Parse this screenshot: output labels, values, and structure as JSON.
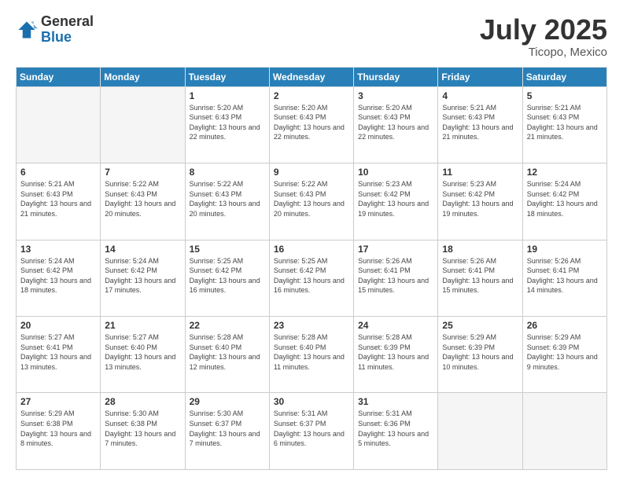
{
  "header": {
    "logo_general": "General",
    "logo_blue": "Blue",
    "month_title": "July 2025",
    "location": "Ticopo, Mexico"
  },
  "calendar": {
    "days_of_week": [
      "Sunday",
      "Monday",
      "Tuesday",
      "Wednesday",
      "Thursday",
      "Friday",
      "Saturday"
    ],
    "weeks": [
      [
        {
          "day": "",
          "info": ""
        },
        {
          "day": "",
          "info": ""
        },
        {
          "day": "1",
          "info": "Sunrise: 5:20 AM\nSunset: 6:43 PM\nDaylight: 13 hours and 22 minutes."
        },
        {
          "day": "2",
          "info": "Sunrise: 5:20 AM\nSunset: 6:43 PM\nDaylight: 13 hours and 22 minutes."
        },
        {
          "day": "3",
          "info": "Sunrise: 5:20 AM\nSunset: 6:43 PM\nDaylight: 13 hours and 22 minutes."
        },
        {
          "day": "4",
          "info": "Sunrise: 5:21 AM\nSunset: 6:43 PM\nDaylight: 13 hours and 21 minutes."
        },
        {
          "day": "5",
          "info": "Sunrise: 5:21 AM\nSunset: 6:43 PM\nDaylight: 13 hours and 21 minutes."
        }
      ],
      [
        {
          "day": "6",
          "info": "Sunrise: 5:21 AM\nSunset: 6:43 PM\nDaylight: 13 hours and 21 minutes."
        },
        {
          "day": "7",
          "info": "Sunrise: 5:22 AM\nSunset: 6:43 PM\nDaylight: 13 hours and 20 minutes."
        },
        {
          "day": "8",
          "info": "Sunrise: 5:22 AM\nSunset: 6:43 PM\nDaylight: 13 hours and 20 minutes."
        },
        {
          "day": "9",
          "info": "Sunrise: 5:22 AM\nSunset: 6:43 PM\nDaylight: 13 hours and 20 minutes."
        },
        {
          "day": "10",
          "info": "Sunrise: 5:23 AM\nSunset: 6:42 PM\nDaylight: 13 hours and 19 minutes."
        },
        {
          "day": "11",
          "info": "Sunrise: 5:23 AM\nSunset: 6:42 PM\nDaylight: 13 hours and 19 minutes."
        },
        {
          "day": "12",
          "info": "Sunrise: 5:24 AM\nSunset: 6:42 PM\nDaylight: 13 hours and 18 minutes."
        }
      ],
      [
        {
          "day": "13",
          "info": "Sunrise: 5:24 AM\nSunset: 6:42 PM\nDaylight: 13 hours and 18 minutes."
        },
        {
          "day": "14",
          "info": "Sunrise: 5:24 AM\nSunset: 6:42 PM\nDaylight: 13 hours and 17 minutes."
        },
        {
          "day": "15",
          "info": "Sunrise: 5:25 AM\nSunset: 6:42 PM\nDaylight: 13 hours and 16 minutes."
        },
        {
          "day": "16",
          "info": "Sunrise: 5:25 AM\nSunset: 6:42 PM\nDaylight: 13 hours and 16 minutes."
        },
        {
          "day": "17",
          "info": "Sunrise: 5:26 AM\nSunset: 6:41 PM\nDaylight: 13 hours and 15 minutes."
        },
        {
          "day": "18",
          "info": "Sunrise: 5:26 AM\nSunset: 6:41 PM\nDaylight: 13 hours and 15 minutes."
        },
        {
          "day": "19",
          "info": "Sunrise: 5:26 AM\nSunset: 6:41 PM\nDaylight: 13 hours and 14 minutes."
        }
      ],
      [
        {
          "day": "20",
          "info": "Sunrise: 5:27 AM\nSunset: 6:41 PM\nDaylight: 13 hours and 13 minutes."
        },
        {
          "day": "21",
          "info": "Sunrise: 5:27 AM\nSunset: 6:40 PM\nDaylight: 13 hours and 13 minutes."
        },
        {
          "day": "22",
          "info": "Sunrise: 5:28 AM\nSunset: 6:40 PM\nDaylight: 13 hours and 12 minutes."
        },
        {
          "day": "23",
          "info": "Sunrise: 5:28 AM\nSunset: 6:40 PM\nDaylight: 13 hours and 11 minutes."
        },
        {
          "day": "24",
          "info": "Sunrise: 5:28 AM\nSunset: 6:39 PM\nDaylight: 13 hours and 11 minutes."
        },
        {
          "day": "25",
          "info": "Sunrise: 5:29 AM\nSunset: 6:39 PM\nDaylight: 13 hours and 10 minutes."
        },
        {
          "day": "26",
          "info": "Sunrise: 5:29 AM\nSunset: 6:39 PM\nDaylight: 13 hours and 9 minutes."
        }
      ],
      [
        {
          "day": "27",
          "info": "Sunrise: 5:29 AM\nSunset: 6:38 PM\nDaylight: 13 hours and 8 minutes."
        },
        {
          "day": "28",
          "info": "Sunrise: 5:30 AM\nSunset: 6:38 PM\nDaylight: 13 hours and 7 minutes."
        },
        {
          "day": "29",
          "info": "Sunrise: 5:30 AM\nSunset: 6:37 PM\nDaylight: 13 hours and 7 minutes."
        },
        {
          "day": "30",
          "info": "Sunrise: 5:31 AM\nSunset: 6:37 PM\nDaylight: 13 hours and 6 minutes."
        },
        {
          "day": "31",
          "info": "Sunrise: 5:31 AM\nSunset: 6:36 PM\nDaylight: 13 hours and 5 minutes."
        },
        {
          "day": "",
          "info": ""
        },
        {
          "day": "",
          "info": ""
        }
      ]
    ]
  }
}
